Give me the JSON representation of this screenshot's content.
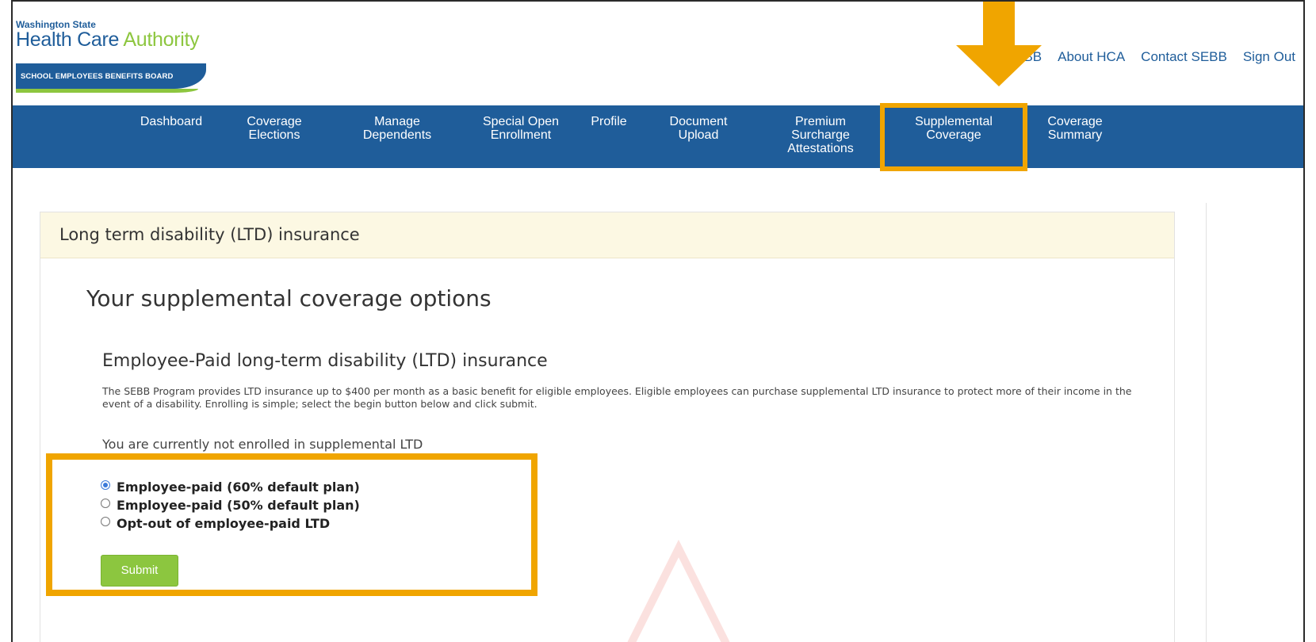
{
  "logo": {
    "line1": "Washington State",
    "line2_part1": "Health Care ",
    "line2_part2": "Authority",
    "banner": "SCHOOL EMPLOYEES BENEFITS BOARD"
  },
  "top_links": [
    "SEBB",
    "About HCA",
    "Contact SEBB",
    "Sign Out"
  ],
  "nav": [
    {
      "line1": "Dashboard",
      "line2": "",
      "line3": ""
    },
    {
      "line1": "Coverage",
      "line2": "Elections",
      "line3": ""
    },
    {
      "line1": "Manage",
      "line2": "Dependents",
      "line3": ""
    },
    {
      "line1": "Special Open",
      "line2": "Enrollment",
      "line3": ""
    },
    {
      "line1": "Profile",
      "line2": "",
      "line3": ""
    },
    {
      "line1": "Document",
      "line2": "Upload",
      "line3": ""
    },
    {
      "line1": "Premium",
      "line2": "Surcharge",
      "line3": "Attestations"
    },
    {
      "line1": "Supplemental",
      "line2": "Coverage",
      "line3": ""
    },
    {
      "line1": "Coverage",
      "line2": "Summary",
      "line3": ""
    }
  ],
  "panel": {
    "header": "Long term disability (LTD) insurance",
    "title": "Your supplemental coverage options",
    "subtitle": "Employee-Paid long-term disability (LTD) insurance",
    "description": "The SEBB Program provides LTD insurance up to $400 per month as a basic benefit for eligible employees. Eligible employees can purchase supplemental LTD insurance to protect more of their income in the event of a disability. Enrolling is simple; select the begin button below and click submit.",
    "status": "You are currently not enrolled in supplemental LTD",
    "options": [
      {
        "label": "Employee-paid (60% default plan)",
        "selected": true
      },
      {
        "label": "Employee-paid (50% default plan)",
        "selected": false
      },
      {
        "label": "Opt-out of employee-paid LTD",
        "selected": false
      }
    ],
    "submit_label": "Submit"
  },
  "colors": {
    "nav_bg": "#1f5d9a",
    "highlight": "#f0a500",
    "submit_bg": "#8cc63f",
    "panel_header_bg": "#fcf8e3"
  }
}
